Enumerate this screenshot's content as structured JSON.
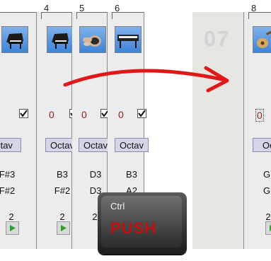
{
  "tracks": [
    {
      "number": "",
      "instrument": "grand-piano-icon",
      "velocity": "",
      "octave_label": "ctav",
      "note_top": "F#3",
      "note_bottom": "F#2",
      "count": "2"
    },
    {
      "number": "4",
      "instrument": "grand-piano-icon",
      "velocity": "0",
      "octave_label": "Octav",
      "note_top": "B3",
      "note_bottom": "F#2",
      "count": "2"
    },
    {
      "number": "5",
      "instrument": "drum-icon",
      "velocity": "0",
      "octave_label": "Octav",
      "note_top": "D3",
      "note_bottom": "D3",
      "count": "2"
    },
    {
      "number": "6",
      "instrument": "keyboard-piano-icon",
      "velocity": "0",
      "octave_label": "Octav",
      "note_top": "B3",
      "note_bottom": "A2",
      "count": ""
    },
    {
      "number": "07",
      "empty": true
    },
    {
      "number": "8",
      "instrument": "guitar-icon",
      "velocity": "0",
      "octave_label": "Oct",
      "note_top": "G",
      "note_bottom": "G",
      "count": "2"
    }
  ],
  "keyboard": {
    "top_label": "Ctrl",
    "bottom_label": "PUSH"
  },
  "colors": {
    "icon_bg": "#4a8fe0",
    "arrow": "#e01818",
    "octave_button": "#d3d6e6",
    "velocity_text": "#9b1b1b"
  }
}
